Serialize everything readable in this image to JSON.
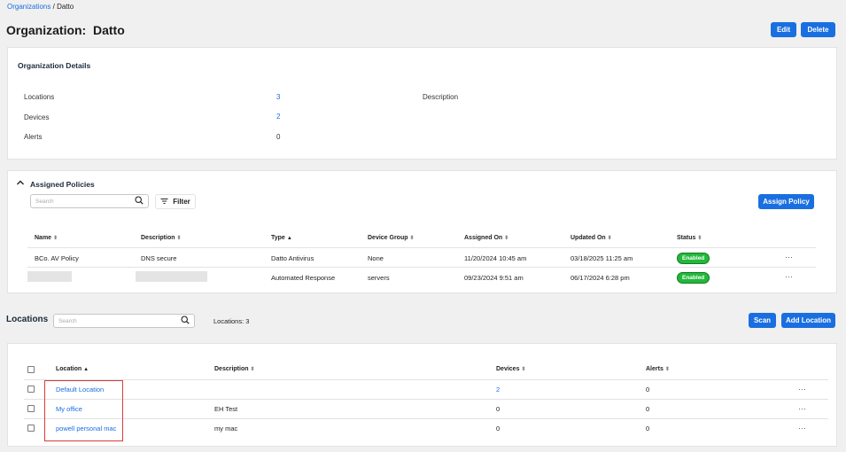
{
  "breadcrumb": {
    "parent": "Organizations",
    "separator": "/",
    "current": "Datto"
  },
  "page": {
    "title": "Organization:  Datto",
    "edit_label": "Edit",
    "delete_label": "Delete"
  },
  "details": {
    "title": "Organization Details",
    "locations_label": "Locations",
    "locations_value": "3",
    "devices_label": "Devices",
    "devices_value": "2",
    "alerts_label": "Alerts",
    "alerts_value": "0",
    "description_label": "Description"
  },
  "policies": {
    "title": "Assigned Policies",
    "search_placeholder": "Search",
    "filter_label": "Filter",
    "assign_label": "Assign Policy",
    "columns": [
      "Name",
      "Description",
      "Type",
      "Device Group",
      "Assigned On",
      "Updated On",
      "Status"
    ],
    "rows": [
      {
        "name": "BCo. AV Policy",
        "description": "DNS secure",
        "type": "Datto Antivirus",
        "group": "None",
        "assigned": "11/20/2024 10:45 am",
        "updated": "03/18/2025 11:25 am",
        "status": "Enabled"
      },
      {
        "name": "",
        "description": "",
        "type": "Automated Response",
        "group": "servers",
        "assigned": "09/23/2024 9:51 am",
        "updated": "06/17/2024 6:28 pm",
        "status": "Enabled"
      }
    ],
    "more": "···"
  },
  "locations": {
    "title": "Locations",
    "search_placeholder": "Search",
    "count_label": "Locations: 3",
    "scan_label": "Scan",
    "add_label": "Add Location",
    "columns": [
      "Location",
      "Description",
      "Devices",
      "Alerts"
    ],
    "rows": [
      {
        "name": "Default Location",
        "description": "",
        "devices": "2",
        "alerts": "0"
      },
      {
        "name": "My office",
        "description": "EH Test",
        "devices": "0",
        "alerts": "0"
      },
      {
        "name": "powell personal mac",
        "description": "my mac",
        "devices": "0",
        "alerts": "0"
      }
    ],
    "more": "···"
  },
  "colors": {
    "accent": "#1a6fe0",
    "enabled": "#22b83a",
    "highlight": "#d83b3b"
  }
}
